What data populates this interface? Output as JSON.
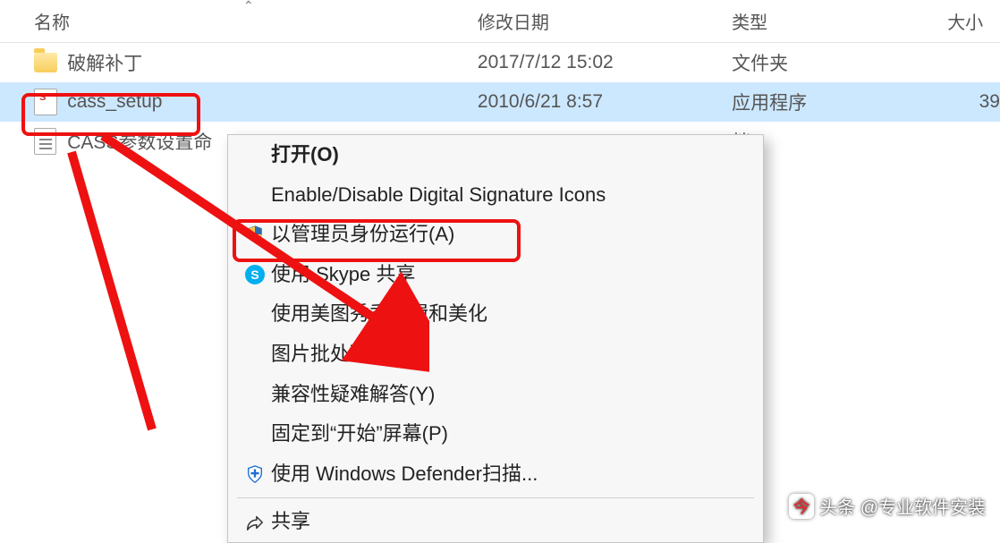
{
  "columns": {
    "name": "名称",
    "modified": "修改日期",
    "type": "类型",
    "size": "大小"
  },
  "rows": [
    {
      "icon": "folder",
      "name": "破解补丁",
      "modified": "2017/7/12 15:02",
      "type": "文件夹",
      "size": ""
    },
    {
      "icon": "exe",
      "name": "cass_setup",
      "modified": "2010/6/21 8:57",
      "type": "应用程序",
      "size": "39",
      "selected": true
    },
    {
      "icon": "txt",
      "name": "CASS参数设置命",
      "modified": "",
      "type": "档",
      "size": ""
    }
  ],
  "context_menu": {
    "open": "打开(O)",
    "sig": "Enable/Disable Digital Signature Icons",
    "admin": "以管理员身份运行(A)",
    "skype": "使用 Skype 共享",
    "meitu": "使用美图秀秀编辑和美化",
    "batch": "图片批处理",
    "compat": "兼容性疑难解答(Y)",
    "pin": "固定到“开始”屏幕(P)",
    "defender": "使用 Windows Defender扫描...",
    "share": "共享"
  },
  "watermark": {
    "text": "头条 @专业软件安装"
  }
}
